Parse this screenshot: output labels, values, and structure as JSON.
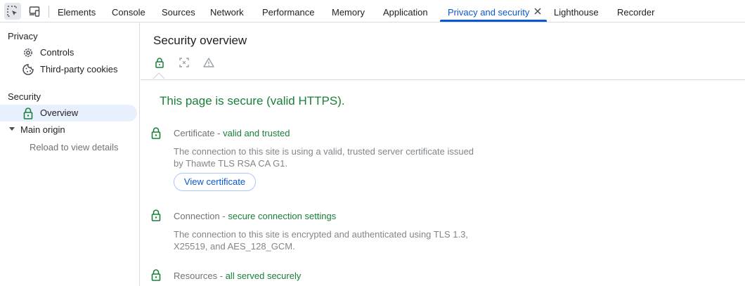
{
  "toolbar": {
    "tabs": [
      "Elements",
      "Console",
      "Sources",
      "Network",
      "Performance",
      "Memory",
      "Application",
      "Privacy and security",
      "Lighthouse",
      "Recorder"
    ],
    "selected_tab": "Privacy and security"
  },
  "sidebar": {
    "privacy_heading": "Privacy",
    "privacy_items": [
      "Controls",
      "Third-party cookies"
    ],
    "security_heading": "Security",
    "overview_label": "Overview",
    "main_origin_label": "Main origin",
    "main_origin_detail": "Reload to view details"
  },
  "main": {
    "title": "Security overview",
    "summary": "This page is secure (valid HTTPS).",
    "certificate": {
      "label": "Certificate",
      "separator": " - ",
      "value": "valid and trusted",
      "desc": "The connection to this site is using a valid, trusted server certificate issued by Thawte TLS RSA CA G1.",
      "button": "View certificate"
    },
    "connection": {
      "label": "Connection",
      "separator": " - ",
      "value": "secure connection settings",
      "desc": "The connection to this site is encrypted and authenticated using TLS 1.3, X25519, and AES_128_GCM."
    },
    "resources": {
      "label": "Resources",
      "separator": " - ",
      "value": "all served securely"
    }
  },
  "colors": {
    "accent": "#0b57d0",
    "secure_green": "#188038",
    "selection_bg": "#e8f0fe"
  },
  "icons": {
    "inspect": "inspect-element-icon",
    "device": "device-toolbar-icon",
    "close": "close-icon",
    "controls": "gear-icon",
    "cookies": "cookie-icon",
    "lock": "lock-icon",
    "focus": "focus-frame-icon",
    "warning": "warning-icon"
  }
}
